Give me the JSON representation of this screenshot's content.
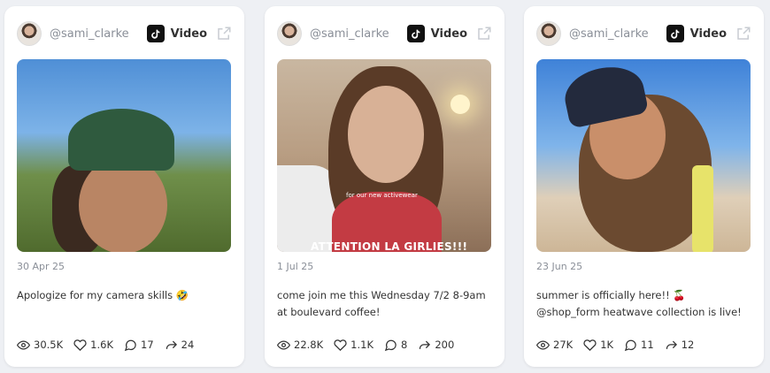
{
  "posts": [
    {
      "handle": "@sami_clarke",
      "platform": "Video",
      "platform_icon": "tiktok-icon",
      "date": "30 Apr 25",
      "caption": "Apologize for my camera skills 🤣",
      "views": "30.5K",
      "likes": "1.6K",
      "comments": "17",
      "shares": "24"
    },
    {
      "handle": "@sami_clarke",
      "platform": "Video",
      "platform_icon": "tiktok-icon",
      "date": "1 Jul 25",
      "caption": "come join me this Wednesday 7/2 8-9am at boulevard coffee!",
      "media_text_small": "for our new activewear",
      "media_text_large": "ATTENTION LA GIRLIES!!!",
      "views": "22.8K",
      "likes": "1.1K",
      "comments": "8",
      "shares": "200"
    },
    {
      "handle": "@sami_clarke",
      "platform": "Video",
      "platform_icon": "tiktok-icon",
      "date": "23 Jun 25",
      "caption": "summer is officially here!! 🍒 @shop_form heatwave collection is live!",
      "views": "27K",
      "likes": "1K",
      "comments": "11",
      "shares": "12"
    }
  ]
}
